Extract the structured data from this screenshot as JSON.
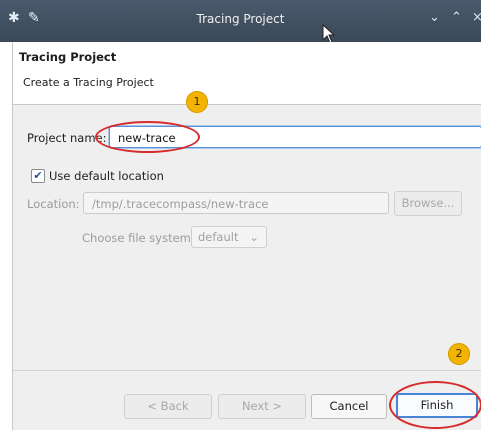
{
  "window": {
    "title": "Tracing Project",
    "app_icon": "star-icon",
    "pin_icon": "pin-icon",
    "controls": [
      "chevron-down-icon",
      "chevron-up-icon",
      "close-icon"
    ]
  },
  "header": {
    "title": "Tracing Project",
    "subtitle": "Create a Tracing Project"
  },
  "form": {
    "project_name_label": "Project name:",
    "project_name_value": "new-trace",
    "use_default_location_label": "Use default location",
    "use_default_location_checked": true,
    "location_label": "Location:",
    "location_value": "/tmp/.tracecompass/new-trace",
    "browse_label": "Browse...",
    "file_system_label": "Choose file system:",
    "file_system_value": "default"
  },
  "buttons": {
    "back": "< Back",
    "next": "Next >",
    "cancel": "Cancel",
    "finish": "Finish"
  },
  "callouts": [
    "1",
    "2"
  ],
  "colors": {
    "callout": "#f2b400",
    "highlight": "#d62c2c",
    "titlebar": "#44525f",
    "default_button_border": "#4a84d6"
  }
}
